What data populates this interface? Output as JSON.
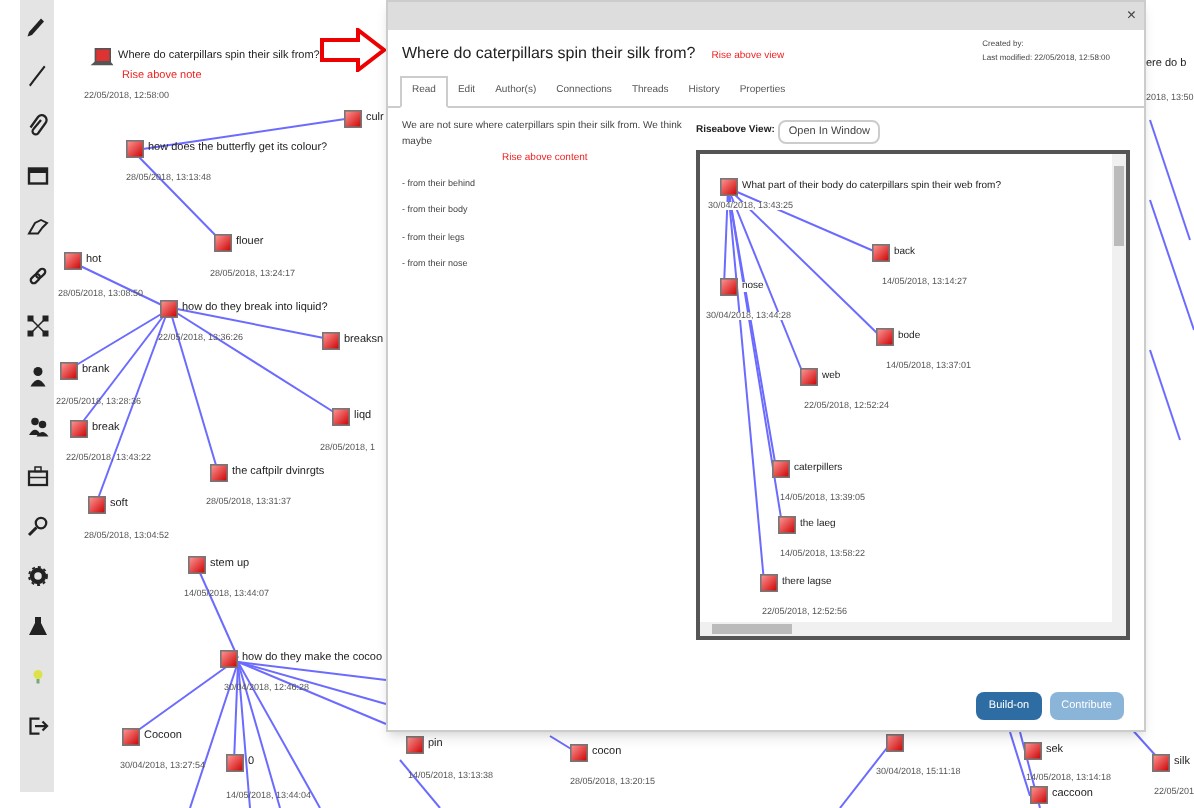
{
  "map": {
    "nodes": [
      {
        "kind": "riseabove",
        "title": "Where do caterpillars spin their silk from?",
        "caption": "Rise above note",
        "date": "22/05/2018, 12:58:00"
      },
      {
        "kind": "fragment",
        "title": "ere do b",
        "date": "2018, 13:50"
      },
      {
        "kind": "note",
        "title": "culr"
      },
      {
        "kind": "note",
        "title": "how does the butterfly get its colour?",
        "date": "28/05/2018, 13:13:48"
      },
      {
        "kind": "note",
        "title": "flouer",
        "date": "28/05/2018, 13:24:17"
      },
      {
        "kind": "note",
        "title": "hot",
        "date": "28/05/2018, 13:08:50"
      },
      {
        "kind": "note",
        "title": "how do they break into liquid?",
        "date": "22/05/2018, 13:36:26"
      },
      {
        "kind": "note",
        "title": "breaksn"
      },
      {
        "kind": "note",
        "title": "brank",
        "date": "22/05/2018, 13:28:36"
      },
      {
        "kind": "note",
        "title": "break",
        "date": "22/05/2018, 13:43:22"
      },
      {
        "kind": "note",
        "title": "liqd",
        "date": "28/05/2018, 1"
      },
      {
        "kind": "note",
        "title": "the caftpilr dvinrgts",
        "date": "28/05/2018, 13:31:37"
      },
      {
        "kind": "note",
        "title": "soft",
        "date": "28/05/2018, 13:04:52"
      },
      {
        "kind": "note",
        "title": "stem up",
        "date": "14/05/2018, 13:44:07"
      },
      {
        "kind": "note",
        "title": "how do they make the cocoo",
        "date": "30/04/2018, 12:46:28"
      },
      {
        "kind": "note",
        "title": "Cocoon",
        "date": "30/04/2018, 13:27:54"
      },
      {
        "kind": "note",
        "title": "0",
        "date": "14/05/2018, 13:44:04"
      },
      {
        "kind": "note",
        "title": "pin",
        "date": "14/05/2018, 13:13:38"
      },
      {
        "kind": "note",
        "title": "cocon",
        "date": "28/05/2018, 13:20:15"
      },
      {
        "kind": "note",
        "date": "30/04/2018, 15:11:18"
      },
      {
        "kind": "note",
        "title": "sek",
        "date": "14/05/2018, 13:14:18"
      },
      {
        "kind": "note",
        "title": "caccoon"
      },
      {
        "kind": "note",
        "title": "silk",
        "date": "22/05/201"
      }
    ]
  },
  "dialog": {
    "close": "×",
    "title": "Where do caterpillars spin their silk from?",
    "caption": "Rise above view",
    "created_by": "Created by:",
    "last_modified": "Last modified: 22/05/2018, 12:58:00",
    "tabs": [
      {
        "label": "Read",
        "selected": true
      },
      {
        "label": "Edit",
        "selected": false
      },
      {
        "label": "Author(s)",
        "selected": false
      },
      {
        "label": "Connections",
        "selected": false
      },
      {
        "label": "Threads",
        "selected": false
      },
      {
        "label": "History",
        "selected": false
      },
      {
        "label": "Properties",
        "selected": false
      }
    ],
    "body": {
      "text": "We are not sure where caterpillars spin their silk from.  We think maybe",
      "caption": "Rise above content",
      "items": [
        "- from their behind",
        "- from their body",
        "- from their legs",
        "- from their nose"
      ]
    },
    "view": {
      "label": "Riseabove View:",
      "open_button": "Open In Window",
      "nodes": [
        {
          "title": "What part of their body do caterpillars spin their web from?",
          "date": "30/04/2018, 13:43:25"
        },
        {
          "title": "back",
          "date": "14/05/2018, 13:14:27"
        },
        {
          "title": "nose",
          "date": "30/04/2018, 13:44:28"
        },
        {
          "title": "bode",
          "date": "14/05/2018, 13:37:01"
        },
        {
          "title": "web",
          "date": "22/05/2018, 12:52:24"
        },
        {
          "title": "caterpillers",
          "date": "14/05/2018, 13:39:05"
        },
        {
          "title": "the laeg",
          "date": "14/05/2018, 13:58:22"
        },
        {
          "title": "there lagse",
          "date": "22/05/2018, 12:52:56"
        }
      ]
    },
    "buttons": [
      {
        "label": "Build-on",
        "disabled": false
      },
      {
        "label": "Contribute",
        "disabled": true
      }
    ]
  }
}
